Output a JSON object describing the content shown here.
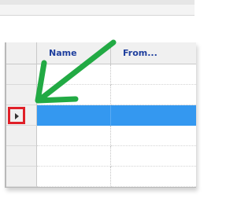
{
  "grid": {
    "columns": [
      {
        "label": "Name"
      },
      {
        "label": "From..."
      }
    ],
    "selected_row_index": 2,
    "row_count": 6
  },
  "colors": {
    "header_text": "#1f3f9e",
    "selection": "#3498f0",
    "highlight_box": "#e02028",
    "annotation_arrow": "#22aa44"
  },
  "icons": {
    "row_pointer": "triangle-right-icon",
    "annotation": "arrow-annotation"
  }
}
